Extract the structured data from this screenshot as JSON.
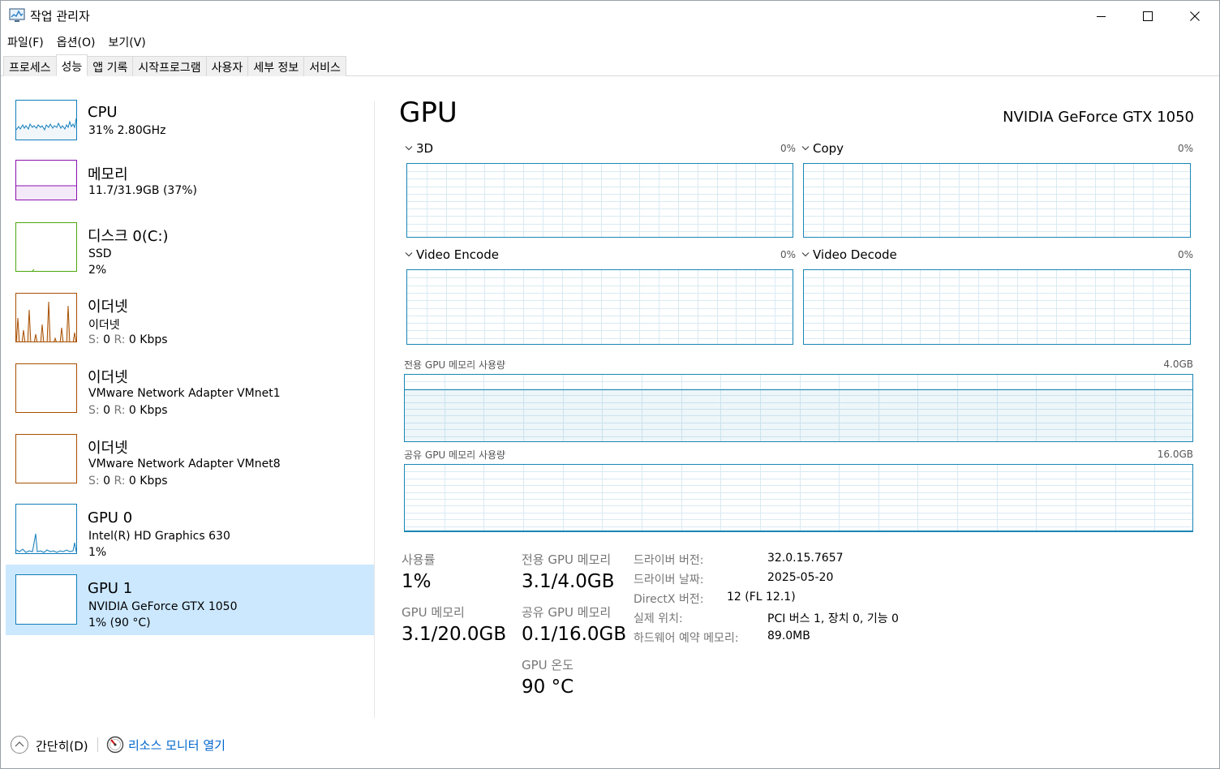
{
  "window": {
    "title": "작업 관리자"
  },
  "menu": [
    "파일(F)",
    "옵션(O)",
    "보기(V)"
  ],
  "tabs": [
    "프로세스",
    "성능",
    "앱 기록",
    "시작프로그램",
    "사용자",
    "세부 정보",
    "서비스"
  ],
  "active_tab": "성능",
  "sidebar": {
    "items": [
      {
        "name": "CPU",
        "lines": [
          "31% 2.80GHz"
        ],
        "color": "#117dbb",
        "selected": false
      },
      {
        "name": "메모리",
        "lines": [
          "11.7/31.9GB (37%)"
        ],
        "color": "#8b12ae",
        "selected": false
      },
      {
        "name": "디스크 0(C:)",
        "lines": [
          "SSD",
          "2%"
        ],
        "color": "#4da60c",
        "selected": false
      },
      {
        "name": "이더넷",
        "lines": [
          "이더넷"
        ],
        "sr": {
          "s_label": "S:",
          "s_val": "0",
          "r_label": "R:",
          "r_val": "0 Kbps"
        },
        "color": "#a74f01",
        "selected": false
      },
      {
        "name": "이더넷",
        "lines": [
          "VMware Network Adapter VMnet1"
        ],
        "sr": {
          "s_label": "S:",
          "s_val": "0",
          "r_label": "R:",
          "r_val": "0 Kbps"
        },
        "color": "#a74f01",
        "selected": false
      },
      {
        "name": "이더넷",
        "lines": [
          "VMware Network Adapter VMnet8"
        ],
        "sr": {
          "s_label": "S:",
          "s_val": "0",
          "r_label": "R:",
          "r_val": "0 Kbps"
        },
        "color": "#a74f01",
        "selected": false
      },
      {
        "name": "GPU 0",
        "lines": [
          "Intel(R) HD Graphics 630",
          "1%"
        ],
        "color": "#117dbb",
        "selected": false
      },
      {
        "name": "GPU 1",
        "lines": [
          "NVIDIA GeForce GTX 1050",
          "1% (90 °C)"
        ],
        "color": "#117dbb",
        "selected": true
      }
    ]
  },
  "main": {
    "title": "GPU",
    "model": "NVIDIA GeForce GTX 1050",
    "engines": [
      {
        "label": "3D",
        "pct": "0%"
      },
      {
        "label": "Copy",
        "pct": "0%"
      },
      {
        "label": "Video Encode",
        "pct": "0%"
      },
      {
        "label": "Video Decode",
        "pct": "0%"
      }
    ],
    "dedicated": {
      "label": "전용 GPU 메모리 사용량",
      "max": "4.0GB",
      "fraction": 0.775
    },
    "shared": {
      "label": "공유 GPU 메모리 사용량",
      "max": "16.0GB",
      "fraction": 0.006
    },
    "stats": {
      "utilization_label": "사용률",
      "utilization": "1%",
      "gpu_mem_label": "GPU 메모리",
      "gpu_mem": "3.1/20.0GB",
      "dedicated_label": "전용 GPU 메모리",
      "dedicated": "3.1/4.0GB",
      "shared_label": "공유 GPU 메모리",
      "shared": "0.1/16.0GB",
      "temp_label": "GPU 온도",
      "temp": "90 °C"
    },
    "info": {
      "driver_version_label": "드라이버 버전:",
      "driver_version": "32.0.15.7657",
      "driver_date_label": "드라이버 날짜:",
      "driver_date": "2025-05-20",
      "directx_label": "DirectX 버전:",
      "directx": "12 (FL 12.1)",
      "location_label": "실제 위치:",
      "location": "PCI 버스 1, 장치 0, 기능 0",
      "reserved_label": "하드웨어 예약 메모리:",
      "reserved": "89.0MB"
    }
  },
  "footer": {
    "fewer_details": "간단히(D)",
    "resource_monitor": "리소스 모니터 열기"
  },
  "colors": {
    "accent": "#1a86b5",
    "selected_bg": "#cce8ff",
    "link": "#0066cc"
  }
}
